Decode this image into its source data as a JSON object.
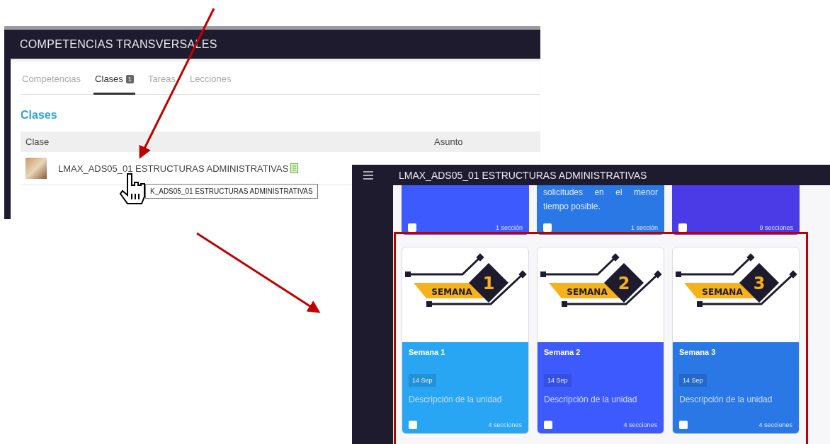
{
  "class_list_screen": {
    "title": "COMPETENCIAS TRANSVERSALES",
    "tabs": [
      {
        "label": "Competencias",
        "selected": false
      },
      {
        "label": "Clases",
        "badge": "1",
        "selected": true
      },
      {
        "label": "Tareas",
        "selected": false
      },
      {
        "label": "Lecciones",
        "selected": false
      }
    ],
    "section_title": "Clases",
    "table": {
      "columns": [
        "Clase",
        "Asunto"
      ],
      "rows": [
        {
          "name": "LMAX_ADS05_01 ESTRUCTURAS ADMINISTRATIVAS"
        }
      ]
    },
    "tooltip": "K_ADS05_01 ESTRUCTURAS ADMINISTRATIVAS"
  },
  "course_screen": {
    "title": "LMAX_ADS05_01 ESTRUCTURAS ADMINISTRATIVAS",
    "top_cards": [
      {
        "color": "#3d5afe",
        "checked": false,
        "sections": "1 sección"
      },
      {
        "text": "solicitudes en el menor tiempo posible.",
        "color": "#2a78e6",
        "checked": false,
        "sections": "1 sección"
      },
      {
        "color": "#4b3be6",
        "checked": false,
        "sections": "9 secciones"
      }
    ],
    "cards": [
      {
        "banner_label": "SEMANA",
        "banner_number": "1",
        "title": "Semana 1",
        "date": "14 Sep",
        "description": "Descripción de la unidad",
        "color": "#28a6f4",
        "checked": false,
        "sections": "4 secciones"
      },
      {
        "banner_label": "SEMANA",
        "banner_number": "2",
        "title": "Semana 2",
        "date": "14 Sep",
        "description": "Descripción de la unidad",
        "color": "#3d5afe",
        "checked": false,
        "sections": "4 secciones"
      },
      {
        "banner_label": "SEMANA",
        "banner_number": "3",
        "title": "Semana 3",
        "date": "14 Sep",
        "description": "Descripción de la unidad",
        "color": "#2a78e6",
        "checked": false,
        "sections": "4 secciones"
      }
    ]
  }
}
